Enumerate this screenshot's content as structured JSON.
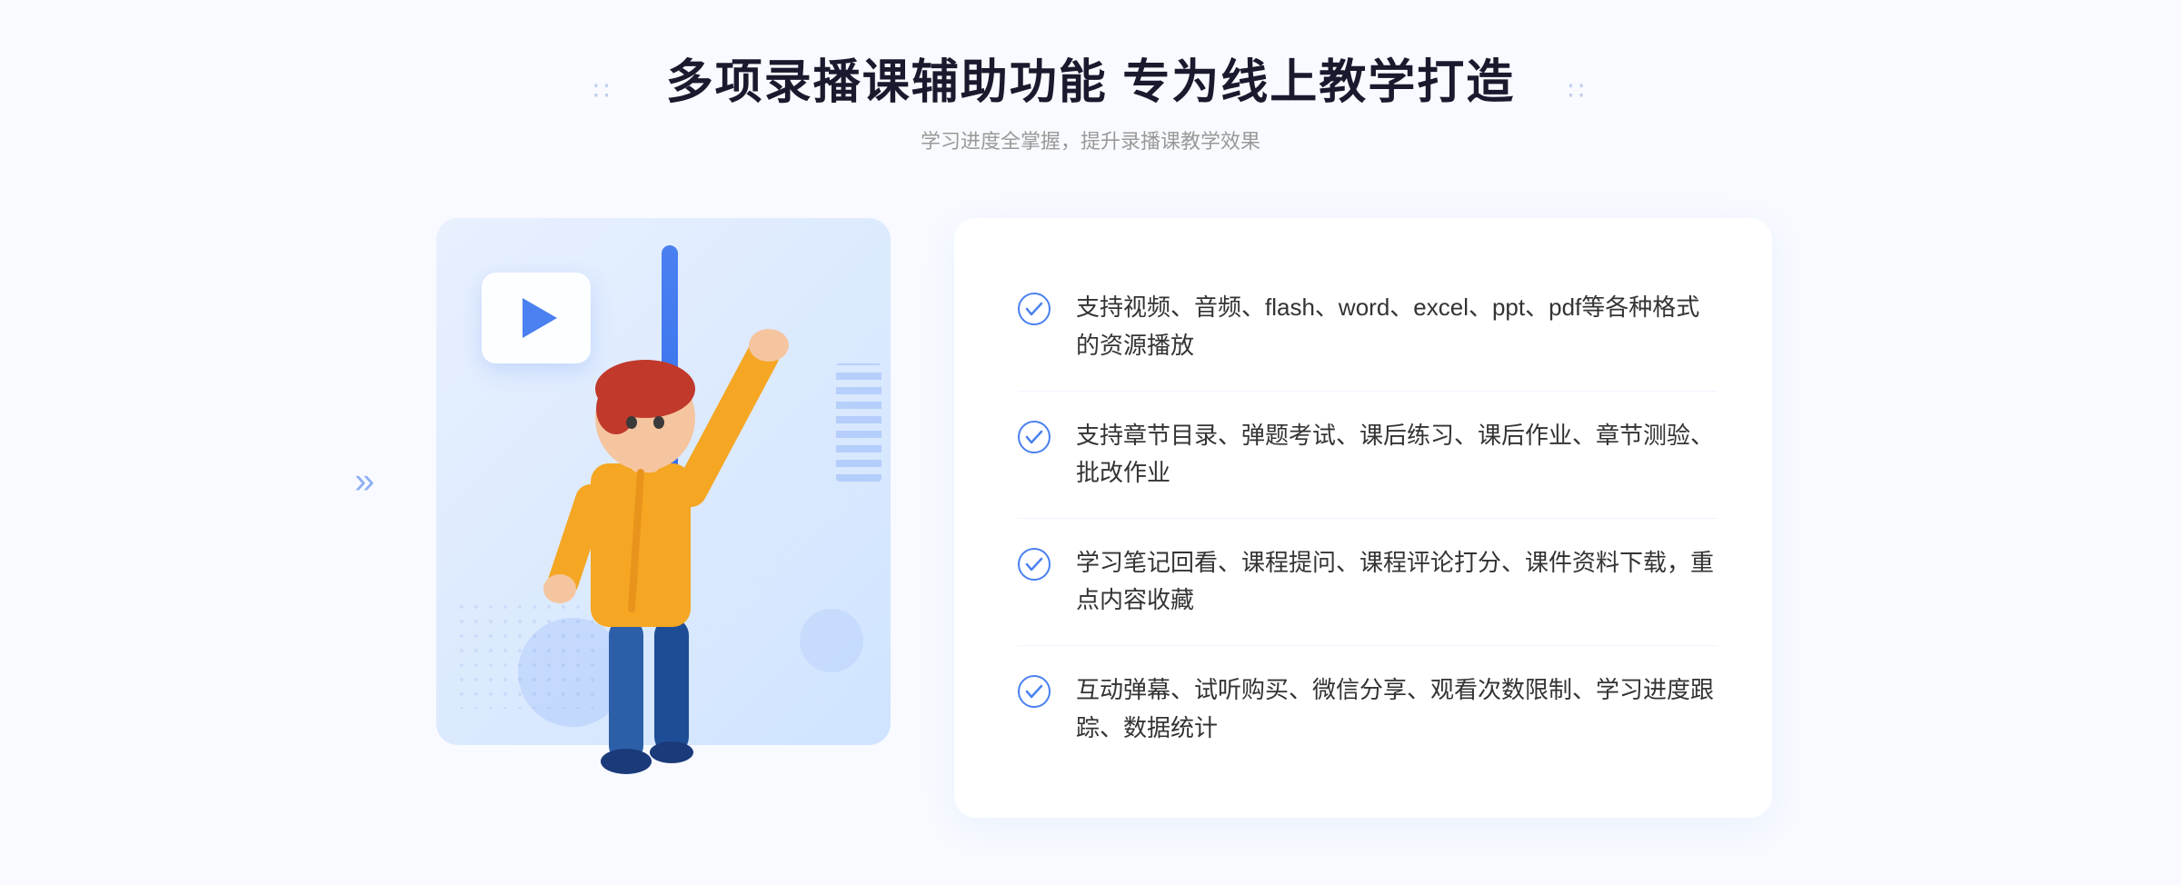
{
  "header": {
    "title": "多项录播课辅助功能 专为线上教学打造",
    "subtitle": "学习进度全掌握，提升录播课教学效果",
    "deco_left": "∷",
    "deco_right": "∷"
  },
  "features": [
    {
      "id": 1,
      "text": "支持视频、音频、flash、word、excel、ppt、pdf等各种格式的资源播放"
    },
    {
      "id": 2,
      "text": "支持章节目录、弹题考试、课后练习、课后作业、章节测验、批改作业"
    },
    {
      "id": 3,
      "text": "学习笔记回看、课程提问、课程评论打分、课件资料下载，重点内容收藏"
    },
    {
      "id": 4,
      "text": "互动弹幕、试听购买、微信分享、观看次数限制、学习进度跟踪、数据统计"
    }
  ],
  "decorations": {
    "chevron": "»",
    "play_icon": "▶"
  }
}
